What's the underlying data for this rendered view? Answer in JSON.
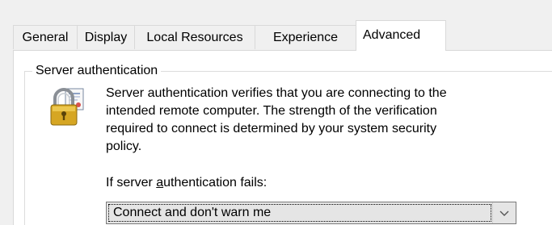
{
  "tabs": [
    {
      "label": "General"
    },
    {
      "label": "Display"
    },
    {
      "label": "Local Resources"
    },
    {
      "label": "Experience"
    },
    {
      "label": "Advanced",
      "active": true
    }
  ],
  "group": {
    "title": "Server authentication",
    "icon": "padlock-certificate-icon",
    "description_lines": [
      "Server authentication verifies that you are connecting to the",
      "intended remote computer. The strength of the verification",
      "required to connect is determined by your system security",
      "policy."
    ],
    "fail_label_pre": "If server ",
    "fail_label_accel": "a",
    "fail_label_post": "uthentication fails:",
    "select": {
      "value": "Connect and don't warn me"
    }
  }
}
